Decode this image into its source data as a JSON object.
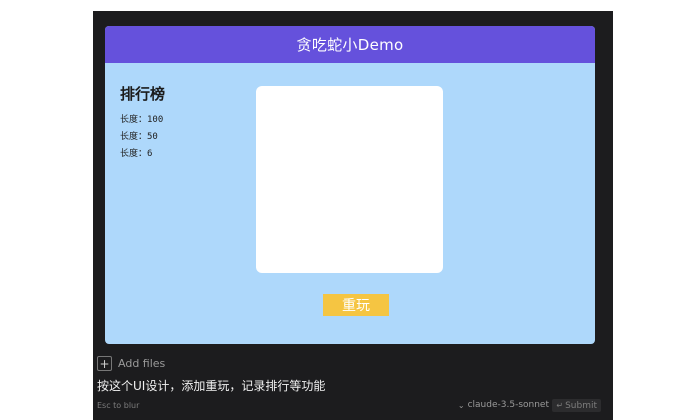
{
  "app": {
    "title": "贪吃蛇小Demo",
    "leaderboard": {
      "title": "排行榜",
      "entries": [
        "长度：100",
        "长度：50",
        "长度：6"
      ]
    },
    "restart_label": "重玩"
  },
  "composer": {
    "add_files_label": "Add files",
    "prompt_text": "按这个UI设计，添加重玩，记录排行等功能",
    "esc_hint": "Esc to blur",
    "model": "claude-3.5-sonnet",
    "submit_label": "Submit"
  },
  "colors": {
    "header": "#6551dc",
    "game_area": "#aed8fb",
    "board": "#ffffff",
    "restart_button": "#f5c542",
    "panel": "#1c1c1e"
  },
  "icons": [
    "plus-icon",
    "chevron-down-icon",
    "enter-icon"
  ]
}
